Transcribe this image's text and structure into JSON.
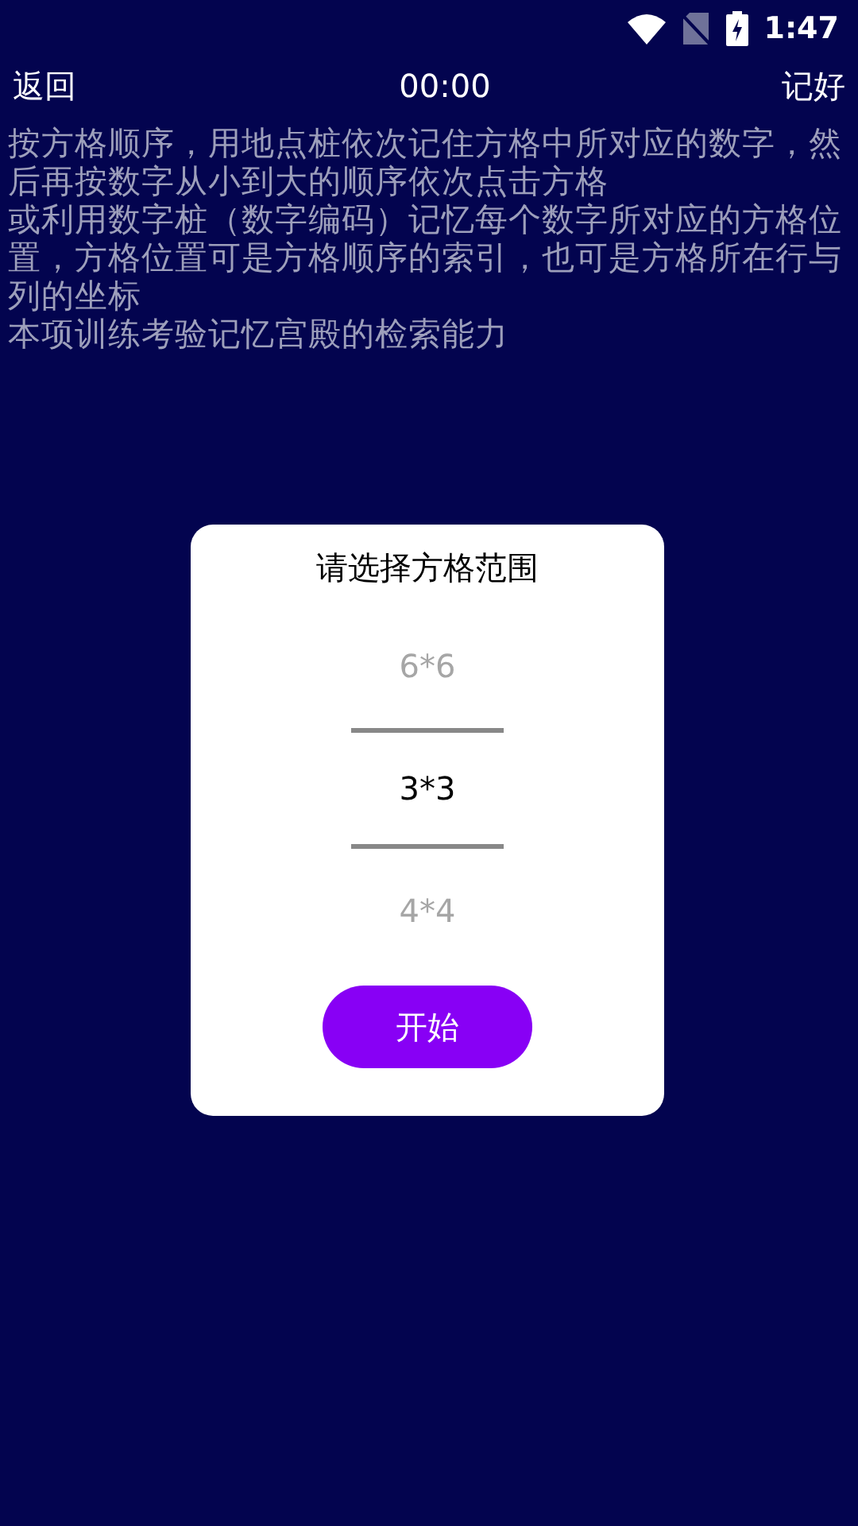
{
  "status_bar": {
    "time": "1:47"
  },
  "top_bar": {
    "back": "返回",
    "timer": "00:00",
    "done": "记好"
  },
  "description": [
    "按方格顺序，用地点桩依次记住方格中所对应的数字，然后再按数字从小到大的顺序依次点击方格",
    "或利用数字桩（数字编码）记忆每个数字所对应的方格位置，方格位置可是方格顺序的索引，也可是方格所在行与列的坐标",
    "本项训练考验记忆宫殿的检索能力"
  ],
  "dialog": {
    "title": "请选择方格范围",
    "options": [
      {
        "label": "6*6",
        "selected": false
      },
      {
        "label": "3*3",
        "selected": true
      },
      {
        "label": "4*4",
        "selected": false
      }
    ],
    "button": "开始"
  }
}
